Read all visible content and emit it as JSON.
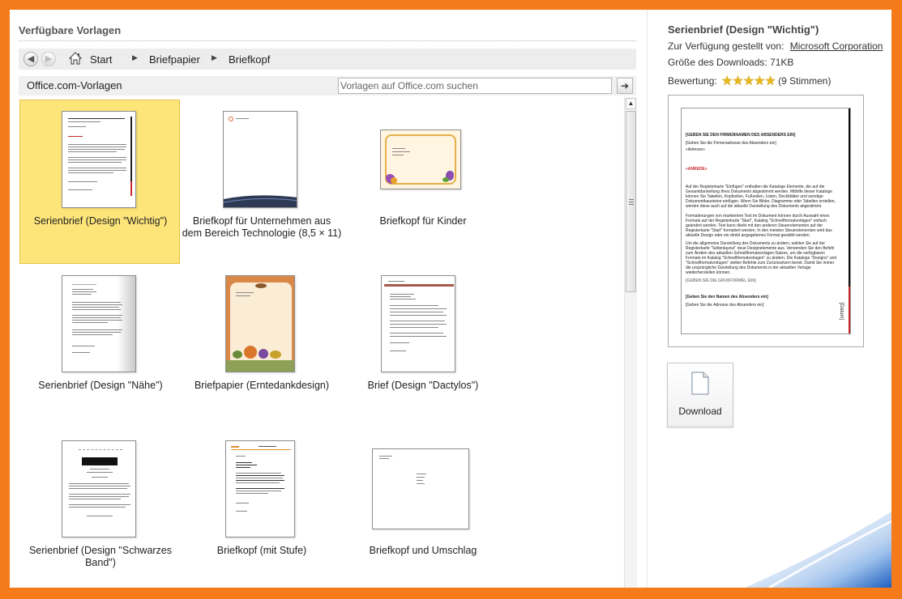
{
  "left_panel": {
    "title": "Verfügbare Vorlagen",
    "breadcrumb": [
      "Start",
      "Briefpapier",
      "Briefkopf"
    ],
    "section_title": "Office.com-Vorlagen",
    "search_placeholder": "Vorlagen auf Office.com suchen"
  },
  "templates": [
    {
      "label": "Serienbrief (Design \"Wichtig\")",
      "selected": true
    },
    {
      "label": "Briefkopf für Unternehmen aus dem Bereich Technologie (8,5 × 11)",
      "selected": false
    },
    {
      "label": "Briefkopf für Kinder",
      "selected": false
    },
    {
      "label": "Serienbrief (Design \"Nähe\")",
      "selected": false
    },
    {
      "label": "Briefpapier (Erntedankdesign)",
      "selected": false
    },
    {
      "label": "Brief (Design \"Dactylos\")",
      "selected": false
    },
    {
      "label": "Serienbrief (Design \"Schwarzes Band\")",
      "selected": false
    },
    {
      "label": "Briefkopf (mit Stufe)",
      "selected": false
    },
    {
      "label": "Briefkopf und Umschlag",
      "selected": false
    }
  ],
  "details": {
    "title": "Serienbrief (Design \"Wichtig\")",
    "provided_by_label": "Zur Verfügung gestellt von:",
    "provided_by_value": "Microsoft Corporation",
    "size_label": "Größe des Downloads:",
    "size_value": "71KB",
    "rating_label": "Bewertung:",
    "rating_stars": "★★★★★",
    "rating_votes": "(9 Stimmen)",
    "download_label": "Download"
  },
  "preview_text": {
    "company": "[GEBEN SIE DEN FIRMENNAMEN DES ABSENDERS EIN]",
    "address_line": "[Geben Sie die Firmenadresse des Absenders ein]",
    "recipient": "«Adresse»",
    "salutation": "«ANREDE»",
    "body1": "Auf der Registerkarte \"Einfügen\" enthalten die Kataloge Elemente, die auf die Gesamtdarstellung Ihres Dokuments abgestimmt werden. Mithilfe dieser Kataloge können Sie Tabellen, Kopfzeilen, Fußzeilen, Listen, Deckblätter und sonstige Dokumentbausteine einfügen. Wenn Sie Bilder, Diagramme oder Tabellen erstellen, werden diese auch auf die aktuelle Darstellung des Dokuments abgestimmt.",
    "body2": "Formatierungen von markiertem Text im Dokument können durch Auswahl eines Formats auf der Registerkarte \"Start\", Katalog \"Schnellformatvorlagen\" einfach geändert werden. Text kann direkt mit den anderen Steuerelementen auf der Registerkarte \"Start\" formatiert werden. In den meisten Steuerelementen wird das aktuelle Design oder ein direkt angegebenes Format gewählt werden.",
    "body3": "Um die allgemeine Darstellung des Dokuments zu ändern, wählen Sie auf der Registerkarte \"Seitenlayout\" neue Designelemente aus. Verwenden Sie den Befehl zum Ändern des aktuellen Schnellformatvorlagen-Satzes, um die verfügbaren Formate im Katalog \"Schnellformatvorlagen\" zu ändern. Die Kataloge \"Designs\" und \"Schnellformatvorlagen\" stellen Befehle zum Zurücksetzen bereit. Damit Sie immer die ursprüngliche Darstellung des Dokuments in der aktuellen Vorlage wiederherstellen können.",
    "closing": "[GEBEN SIE DIE GRUßFORMEL EIN]",
    "sender_name": "[Geben Sie den Namen des Absenders ein]",
    "sender_address": "[Geben Sie die Adresse des Absenders ein]",
    "date": "[Datum]"
  },
  "colors": {
    "frame": "#f47a1a",
    "selected_tile": "#fde57a",
    "preview_accent": "#c52a2a"
  }
}
